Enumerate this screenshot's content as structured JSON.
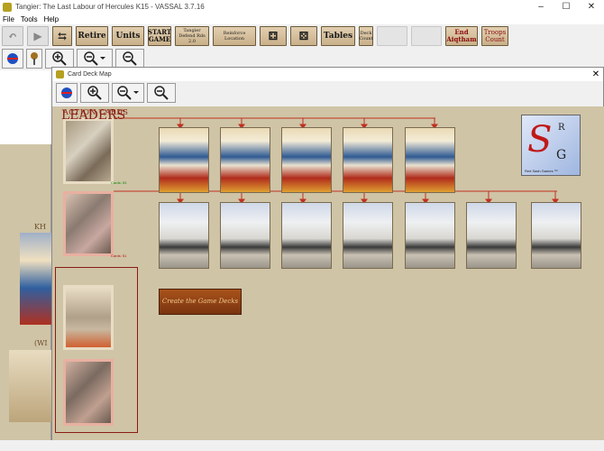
{
  "window": {
    "title": "Tangier: The Last Labour of Hercules K15 - VASSAL 3.7.16"
  },
  "menu": [
    "File",
    "Tools",
    "Help"
  ],
  "toolbar": {
    "retire": "Retire",
    "units": "Units",
    "start_game": "START GAME",
    "tangier_defend": "Tangier Defend Rds 2.0",
    "reinforce_location": "Reinforce Location",
    "tables": "Tables",
    "deck_count": "Deck Count",
    "end_aiqtham": "End Aiqtham",
    "troops_count": "Troops Count"
  },
  "main_map": {
    "label_top": "KH",
    "label_mid": "(WI"
  },
  "deck_map": {
    "title": "Card Deck Map",
    "action_cards_label": "ACTION CARDS",
    "leaders_label": "LEADERS",
    "deck1_count": "Cards: 53",
    "deck2_count": "Cards: 51",
    "create_button": "Create the Game Decks",
    "logo_big": "S",
    "logo_r": "R",
    "logo_g": "G",
    "logo_caption": "Red Sash Games ™"
  },
  "colors": {
    "map_bg": "#cfc4a6",
    "accent_red": "#8a1c14",
    "toolbar_btn": "#c9b08a"
  },
  "icons": [
    "undo-icon",
    "step-icon",
    "arrows-icon",
    "dice-icon",
    "globe-icon",
    "zoom-in-icon",
    "zoom-select-icon",
    "zoom-out-icon"
  ]
}
